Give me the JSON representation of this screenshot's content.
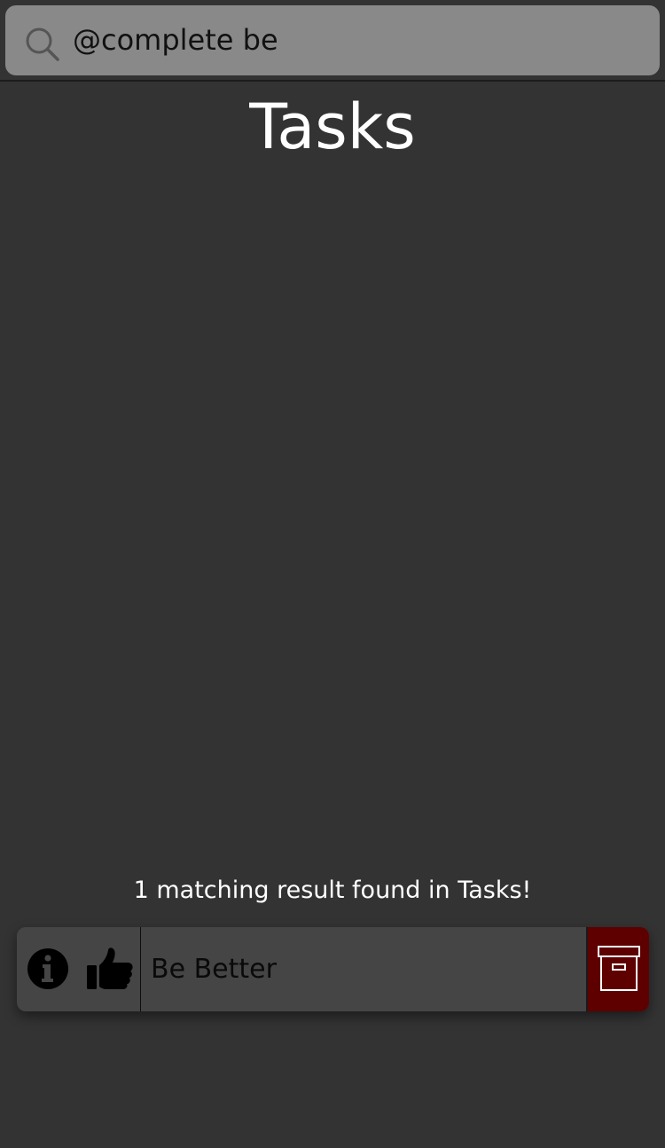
{
  "search": {
    "value": "@complete be",
    "icon": "search-icon"
  },
  "header": {
    "title": "Tasks"
  },
  "results": {
    "summary": "1 matching result found in Tasks!"
  },
  "tasks": [
    {
      "title": "Be Better",
      "actions": [
        "info-icon",
        "thumbs-up-icon"
      ],
      "archive_icon": "archive-icon",
      "archive_color": "#5e0000"
    }
  ],
  "colors": {
    "background": "#333333",
    "search_field": "#898989",
    "card": "#454545",
    "archive": "#5e0000",
    "text_primary": "#ffffff"
  }
}
